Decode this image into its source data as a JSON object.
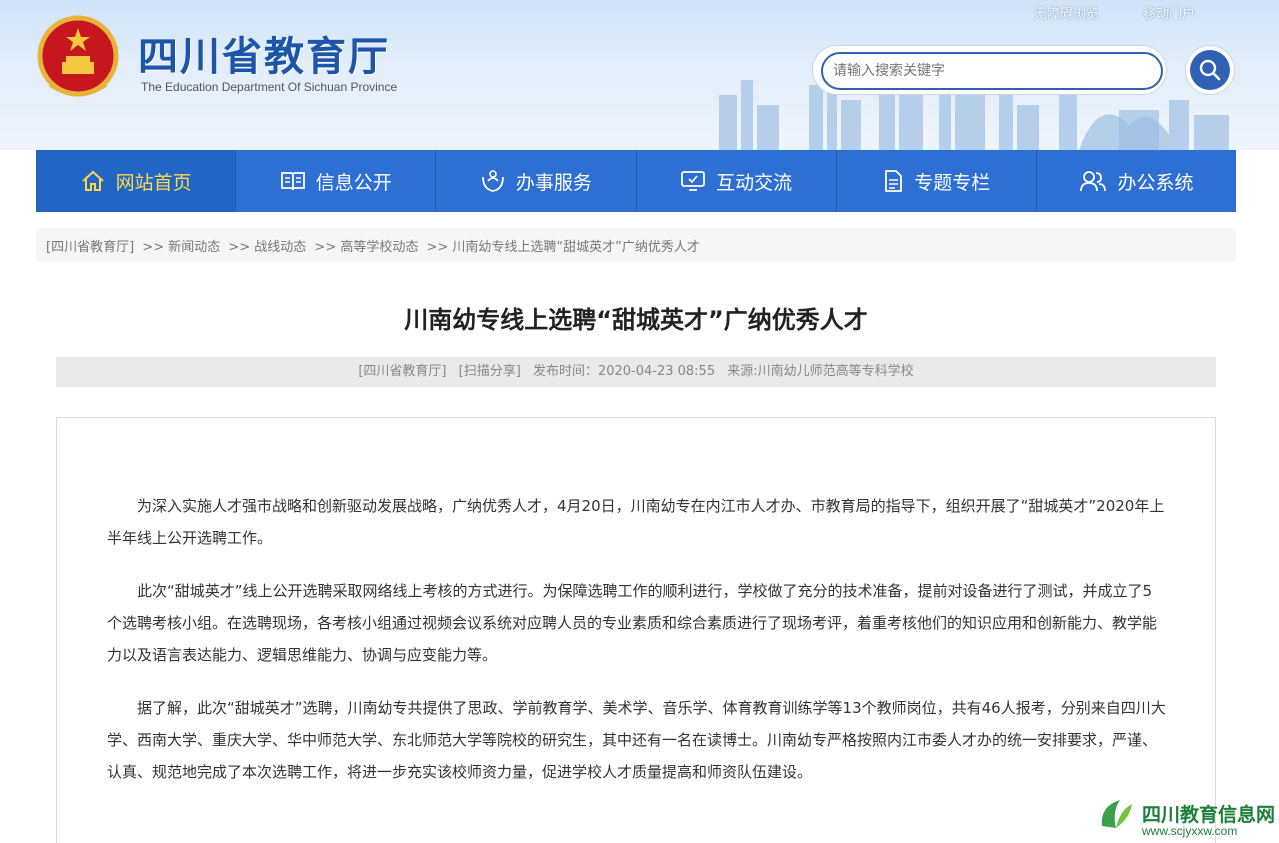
{
  "header": {
    "title": "四川省教育厅",
    "subtitle": "The Education Department Of Sichuan Province",
    "toplinks": [
      "无障碍浏览",
      "移动门户"
    ],
    "search_placeholder": "请输入搜索关键字"
  },
  "nav": [
    {
      "label": "网站首页",
      "icon": "home-icon"
    },
    {
      "label": "信息公开",
      "icon": "book-icon"
    },
    {
      "label": "办事服务",
      "icon": "service-icon"
    },
    {
      "label": "互动交流",
      "icon": "monitor-icon"
    },
    {
      "label": "专题专栏",
      "icon": "document-icon"
    },
    {
      "label": "办公系统",
      "icon": "users-icon"
    }
  ],
  "breadcrumb": [
    "[四川省教育厅]",
    ">> 新闻动态",
    ">> 战线动态",
    ">> 高等学校动态",
    ">> 川南幼专线上选聘“甜城英才”广纳优秀人才"
  ],
  "article": {
    "title": "川南幼专线上选聘“甜城英才”广纳优秀人才",
    "meta": [
      "[四川省教育厅]",
      "[扫描分享]",
      "发布时间：2020-04-23 08:55",
      "来源:川南幼儿师范高等专科学校"
    ],
    "paragraphs": [
      "为深入实施人才强市战略和创新驱动发展战略，广纳优秀人才，4月20日，川南幼专在内江市人才办、市教育局的指导下，组织开展了“甜城英才”2020年上半年线上公开选聘工作。",
      "此次“甜城英才”线上公开选聘采取网络线上考核的方式进行。为保障选聘工作的顺利进行，学校做了充分的技术准备，提前对设备进行了测试，并成立了5个选聘考核小组。在选聘现场，各考核小组通过视频会议系统对应聘人员的专业素质和综合素质进行了现场考评，着重考核他们的知识应用和创新能力、教学能力以及语言表达能力、逻辑思维能力、协调与应变能力等。",
      "据了解，此次“甜城英才”选聘，川南幼专共提供了思政、学前教育学、美术学、音乐学、体育教育训练学等13个教师岗位，共有46人报考，分别来自四川大学、西南大学、重庆大学、华中师范大学、东北师范大学等院校的研究生，其中还有一名在读博士。川南幼专严格按照内江市委人才办的统一安排要求，严谨、认真、规范地完成了本次选聘工作，将进一步充实该校师资力量，促进学校人才质量提高和师资队伍建设。"
    ]
  },
  "watermark": {
    "title": "四川教育信息网",
    "url": "www.scjyxxw.com"
  },
  "colors": {
    "nav_bg": "#2e6fd3",
    "nav_active_text": "#ffd84a",
    "brand": "#1d55a8"
  }
}
